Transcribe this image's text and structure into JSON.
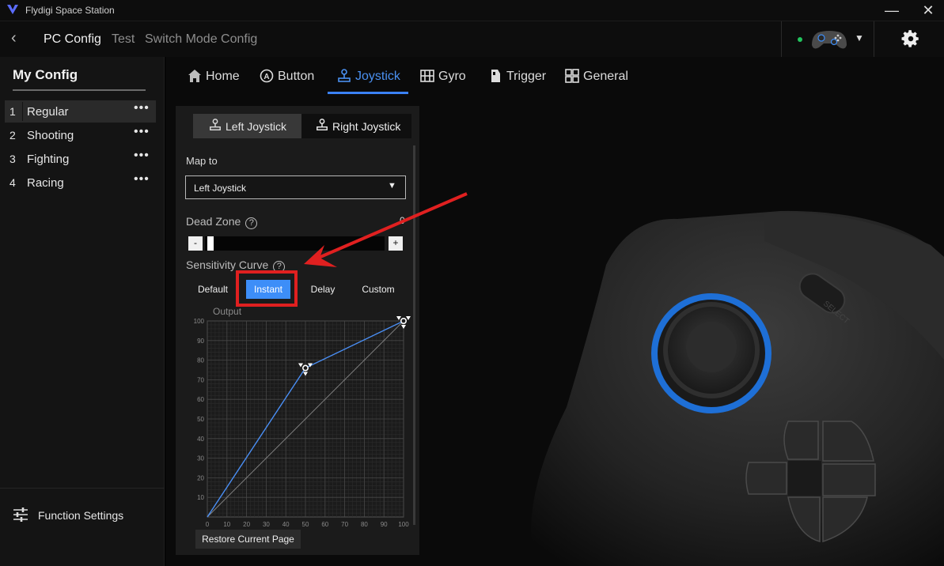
{
  "app": {
    "title": "Flydigi Space Station"
  },
  "header": {
    "breadcrumbs": [
      "PC Config",
      "Test",
      "Switch Mode Config"
    ],
    "device_status_color": "#22c55e"
  },
  "sidebar": {
    "heading": "My Config",
    "configs": [
      {
        "num": "1",
        "name": "Regular"
      },
      {
        "num": "2",
        "name": "Shooting"
      },
      {
        "num": "3",
        "name": "Fighting"
      },
      {
        "num": "4",
        "name": "Racing"
      }
    ],
    "more_glyph": "•••",
    "function_settings": "Function Settings"
  },
  "tabs": [
    {
      "label": "Home",
      "icon": "home-icon"
    },
    {
      "label": "Button",
      "icon": "button-icon"
    },
    {
      "label": "Joystick",
      "icon": "joystick-icon",
      "active": true
    },
    {
      "label": "Gyro",
      "icon": "gyro-icon"
    },
    {
      "label": "Trigger",
      "icon": "trigger-icon"
    },
    {
      "label": "General",
      "icon": "general-icon"
    }
  ],
  "joystick": {
    "left_tab": "Left Joystick",
    "right_tab": "Right Joystick",
    "active_tab": "Right Joystick",
    "map_to_label": "Map to",
    "map_to_value": "Left Joystick",
    "dead_zone_label": "Dead Zone",
    "dead_zone_value": "0",
    "help_glyph": "?",
    "minus": "-",
    "plus": "+",
    "sensitivity_label": "Sensitivity Curve",
    "curve_options": [
      "Default",
      "Instant",
      "Delay",
      "Custom"
    ],
    "selected_curve": "Instant",
    "restore_label": "Restore Current Page"
  },
  "chart_data": {
    "type": "line",
    "title": "",
    "ylabel": "Output",
    "xlabel": "",
    "xlim": [
      0,
      100
    ],
    "ylim": [
      0,
      100
    ],
    "x_ticks": [
      0,
      10,
      20,
      30,
      40,
      50,
      60,
      70,
      80,
      90,
      100
    ],
    "y_ticks": [
      10,
      20,
      30,
      40,
      50,
      60,
      70,
      80,
      90,
      100
    ],
    "grid": true,
    "series": [
      {
        "x": [
          0,
          50,
          100
        ],
        "y": [
          0,
          76,
          100
        ],
        "color": "#4a8ff5"
      },
      {
        "x": [
          0,
          100
        ],
        "y": [
          0,
          100
        ],
        "color": "#8a8a8a"
      }
    ],
    "control_points": [
      {
        "x": 50,
        "y": 76
      },
      {
        "x": 100,
        "y": 100
      }
    ]
  },
  "colors": {
    "accent": "#3d8ef8",
    "annotation": "#e02020"
  }
}
